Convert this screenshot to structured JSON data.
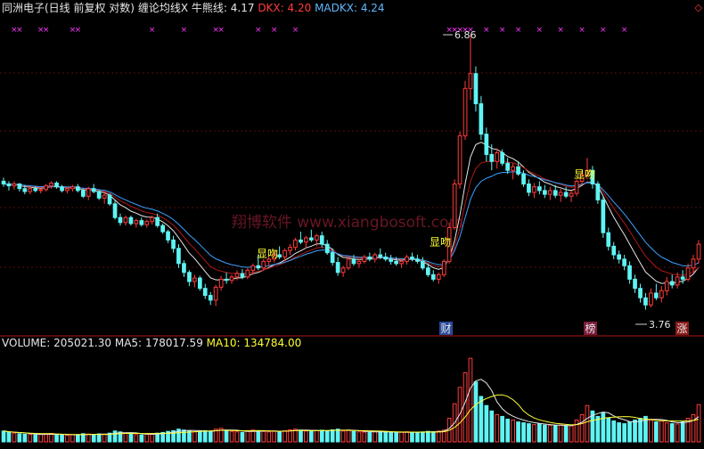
{
  "header": {
    "title": "同洲电子(日线 前复权 对数)",
    "indicator": "缠论均线X",
    "bull_bear_label": "牛熊线:",
    "bull_bear_value": "4.17",
    "dkx_label": "DKX:",
    "dkx_value": "4.20",
    "madkx_label": "MADKX:",
    "madkx_value": "4.24",
    "corner_icon": "diamond-icon"
  },
  "volume_header": {
    "volume_label": "VOLUME:",
    "volume_value": "205021.30",
    "ma5_label": "MA5:",
    "ma5_value": "178017.59",
    "ma10_label": "MA10:",
    "ma10_value": "134784.00"
  },
  "annotations": {
    "high_price": "6.86",
    "low_price": "3.76",
    "kiss_label": "显吻",
    "badge_cai": "财",
    "badge_bang": "榜",
    "badge_zhang": "涨",
    "watermark": "翔博软件 www.xiangbosoft.com"
  },
  "colors": {
    "up": "#ff3b3b",
    "down": "#5ff4f4",
    "ma_white": "#e6e6e6",
    "ma_red": "#b01818",
    "ma_blue": "#3aa0ff",
    "vol_ma10": "#ffff33",
    "marker": "#ff33ff"
  },
  "chart_data": {
    "type": "candlestick",
    "price_range": [
      3.7,
      6.9
    ],
    "volume_range": [
      0,
      500000
    ],
    "candles": [
      [
        4.98,
        5.02,
        4.92,
        4.95
      ],
      [
        4.95,
        4.98,
        4.88,
        4.93
      ],
      [
        4.93,
        4.98,
        4.89,
        4.95
      ],
      [
        4.95,
        4.96,
        4.87,
        4.9
      ],
      [
        4.9,
        4.94,
        4.84,
        4.87
      ],
      [
        4.87,
        4.92,
        4.84,
        4.9
      ],
      [
        4.9,
        4.93,
        4.86,
        4.88
      ],
      [
        4.88,
        4.9,
        4.85,
        4.89
      ],
      [
        4.89,
        4.95,
        4.87,
        4.93
      ],
      [
        4.93,
        4.98,
        4.9,
        4.96
      ],
      [
        4.96,
        4.98,
        4.9,
        4.92
      ],
      [
        4.92,
        4.94,
        4.86,
        4.88
      ],
      [
        4.88,
        4.91,
        4.85,
        4.9
      ],
      [
        4.9,
        4.94,
        4.87,
        4.92
      ],
      [
        4.92,
        4.95,
        4.86,
        4.88
      ],
      [
        4.88,
        4.9,
        4.8,
        4.82
      ],
      [
        4.82,
        4.92,
        4.78,
        4.9
      ],
      [
        4.9,
        4.95,
        4.85,
        4.87
      ],
      [
        4.87,
        4.89,
        4.78,
        4.8
      ],
      [
        4.8,
        4.86,
        4.74,
        4.83
      ],
      [
        4.83,
        4.85,
        4.72,
        4.74
      ],
      [
        4.74,
        4.78,
        4.58,
        4.6
      ],
      [
        4.6,
        4.64,
        4.52,
        4.55
      ],
      [
        4.55,
        4.62,
        4.52,
        4.6
      ],
      [
        4.6,
        4.62,
        4.52,
        4.54
      ],
      [
        4.54,
        4.59,
        4.5,
        4.57
      ],
      [
        4.57,
        4.6,
        4.51,
        4.53
      ],
      [
        4.53,
        4.58,
        4.5,
        4.56
      ],
      [
        4.56,
        4.62,
        4.53,
        4.6
      ],
      [
        4.6,
        4.64,
        4.5,
        4.52
      ],
      [
        4.52,
        4.54,
        4.44,
        4.46
      ],
      [
        4.46,
        4.48,
        4.35,
        4.38
      ],
      [
        4.38,
        4.42,
        4.26,
        4.3
      ],
      [
        4.3,
        4.34,
        4.12,
        4.16
      ],
      [
        4.16,
        4.19,
        4.04,
        4.08
      ],
      [
        4.08,
        4.1,
        3.96,
        4.0
      ],
      [
        4.0,
        4.06,
        3.95,
        4.03
      ],
      [
        4.03,
        4.05,
        3.92,
        3.94
      ],
      [
        3.94,
        3.98,
        3.85,
        3.88
      ],
      [
        3.88,
        3.91,
        3.8,
        3.84
      ],
      [
        3.84,
        3.97,
        3.79,
        3.95
      ],
      [
        3.95,
        4.05,
        3.92,
        4.02
      ],
      [
        4.02,
        4.08,
        3.98,
        4.01
      ],
      [
        4.01,
        4.06,
        3.98,
        4.04
      ],
      [
        4.04,
        4.1,
        4.01,
        4.07
      ],
      [
        4.07,
        4.11,
        4.02,
        4.04
      ],
      [
        4.04,
        4.12,
        4.02,
        4.1
      ],
      [
        4.1,
        4.16,
        4.06,
        4.14
      ],
      [
        4.14,
        4.24,
        4.1,
        4.12
      ],
      [
        4.12,
        4.2,
        4.1,
        4.18
      ],
      [
        4.18,
        4.23,
        4.14,
        4.2
      ],
      [
        4.2,
        4.27,
        4.17,
        4.24
      ],
      [
        4.24,
        4.32,
        4.2,
        4.22
      ],
      [
        4.22,
        4.3,
        4.18,
        4.28
      ],
      [
        4.28,
        4.34,
        4.24,
        4.31
      ],
      [
        4.31,
        4.4,
        4.28,
        4.38
      ],
      [
        4.38,
        4.46,
        4.34,
        4.36
      ],
      [
        4.36,
        4.42,
        4.3,
        4.4
      ],
      [
        4.4,
        4.48,
        4.36,
        4.38
      ],
      [
        4.38,
        4.44,
        4.32,
        4.42
      ],
      [
        4.42,
        4.46,
        4.31,
        4.34
      ],
      [
        4.34,
        4.38,
        4.24,
        4.26
      ],
      [
        4.26,
        4.3,
        4.14,
        4.17
      ],
      [
        4.17,
        4.22,
        4.05,
        4.08
      ],
      [
        4.08,
        4.14,
        4.04,
        4.12
      ],
      [
        4.12,
        4.22,
        4.1,
        4.2
      ],
      [
        4.2,
        4.24,
        4.14,
        4.16
      ],
      [
        4.16,
        4.2,
        4.12,
        4.18
      ],
      [
        4.18,
        4.24,
        4.16,
        4.22
      ],
      [
        4.22,
        4.26,
        4.18,
        4.2
      ],
      [
        4.2,
        4.26,
        4.17,
        4.24
      ],
      [
        4.24,
        4.3,
        4.2,
        4.22
      ],
      [
        4.22,
        4.26,
        4.18,
        4.2
      ],
      [
        4.2,
        4.24,
        4.15,
        4.18
      ],
      [
        4.18,
        4.22,
        4.14,
        4.16
      ],
      [
        4.16,
        4.2,
        4.12,
        4.18
      ],
      [
        4.18,
        4.24,
        4.15,
        4.22
      ],
      [
        4.22,
        4.26,
        4.18,
        4.2
      ],
      [
        4.2,
        4.24,
        4.16,
        4.18
      ],
      [
        4.18,
        4.22,
        4.1,
        4.12
      ],
      [
        4.12,
        4.16,
        4.04,
        4.06
      ],
      [
        4.06,
        4.1,
        4.0,
        4.02
      ],
      [
        4.02,
        4.08,
        3.98,
        4.06
      ],
      [
        4.06,
        4.2,
        4.04,
        4.18
      ],
      [
        4.18,
        4.55,
        4.16,
        4.5
      ],
      [
        4.5,
        5.0,
        4.48,
        4.95
      ],
      [
        4.95,
        5.55,
        4.9,
        5.5
      ],
      [
        5.5,
        6.2,
        5.45,
        6.1
      ],
      [
        6.1,
        6.86,
        5.95,
        6.3
      ],
      [
        6.3,
        6.4,
        5.8,
        5.9
      ],
      [
        5.9,
        6.0,
        5.45,
        5.52
      ],
      [
        5.52,
        5.6,
        5.2,
        5.28
      ],
      [
        5.28,
        5.4,
        5.1,
        5.2
      ],
      [
        5.2,
        5.35,
        5.12,
        5.3
      ],
      [
        5.3,
        5.34,
        5.15,
        5.18
      ],
      [
        5.18,
        5.24,
        5.06,
        5.1
      ],
      [
        5.1,
        5.18,
        5.0,
        5.14
      ],
      [
        5.14,
        5.2,
        5.04,
        5.06
      ],
      [
        5.06,
        5.1,
        4.92,
        4.95
      ],
      [
        4.95,
        5.0,
        4.82,
        4.86
      ],
      [
        4.86,
        4.96,
        4.8,
        4.92
      ],
      [
        4.92,
        4.98,
        4.84,
        4.88
      ],
      [
        4.88,
        4.94,
        4.8,
        4.84
      ],
      [
        4.84,
        4.92,
        4.78,
        4.88
      ],
      [
        4.88,
        4.94,
        4.8,
        4.83
      ],
      [
        4.83,
        4.9,
        4.76,
        4.86
      ],
      [
        4.86,
        4.92,
        4.8,
        4.82
      ],
      [
        4.82,
        4.88,
        4.76,
        4.85
      ],
      [
        4.85,
        5.0,
        4.82,
        4.98
      ],
      [
        4.98,
        5.1,
        4.94,
        5.05
      ],
      [
        5.05,
        5.24,
        5.0,
        5.1
      ],
      [
        5.1,
        5.15,
        4.9,
        4.95
      ],
      [
        4.95,
        4.98,
        4.74,
        4.78
      ],
      [
        4.78,
        4.82,
        4.4,
        4.45
      ],
      [
        4.45,
        4.5,
        4.28,
        4.32
      ],
      [
        4.32,
        4.36,
        4.2,
        4.24
      ],
      [
        4.24,
        4.28,
        4.16,
        4.2
      ],
      [
        4.2,
        4.24,
        4.1,
        4.14
      ],
      [
        4.14,
        4.18,
        3.98,
        4.02
      ],
      [
        4.02,
        4.06,
        3.9,
        3.94
      ],
      [
        3.94,
        3.98,
        3.82,
        3.86
      ],
      [
        3.86,
        3.9,
        3.76,
        3.8
      ],
      [
        3.8,
        3.94,
        3.78,
        3.9
      ],
      [
        3.9,
        3.98,
        3.84,
        3.86
      ],
      [
        3.86,
        3.96,
        3.82,
        3.92
      ],
      [
        3.92,
        4.04,
        3.88,
        4.0
      ],
      [
        4.0,
        4.06,
        3.94,
        3.97
      ],
      [
        3.97,
        4.08,
        3.94,
        4.04
      ],
      [
        4.04,
        4.1,
        3.98,
        4.02
      ],
      [
        4.02,
        4.16,
        4.0,
        4.12
      ],
      [
        4.12,
        4.24,
        4.08,
        4.2
      ],
      [
        4.2,
        4.38,
        4.16,
        4.34
      ]
    ],
    "volumes": [
      60000,
      52000,
      48000,
      45000,
      42000,
      40000,
      38000,
      41000,
      44000,
      46000,
      40000,
      38000,
      36000,
      39000,
      40000,
      45000,
      43000,
      40000,
      44000,
      42000,
      48000,
      60000,
      55000,
      48000,
      44000,
      40000,
      38000,
      42000,
      45000,
      48000,
      52000,
      58000,
      62000,
      70000,
      65000,
      60000,
      55000,
      58000,
      62000,
      60000,
      70000,
      75000,
      62000,
      58000,
      55000,
      52000,
      60000,
      65000,
      62000,
      58000,
      55000,
      60000,
      58000,
      62000,
      66000,
      70000,
      65000,
      60000,
      58000,
      62000,
      64000,
      62000,
      66000,
      70000,
      60000,
      65000,
      58000,
      55000,
      54000,
      52000,
      56000,
      58000,
      54000,
      52000,
      50000,
      53000,
      56000,
      54000,
      52000,
      55000,
      58000,
      56000,
      60000,
      65000,
      130000,
      210000,
      300000,
      380000,
      460000,
      330000,
      250000,
      200000,
      170000,
      150000,
      140000,
      125000,
      120000,
      110000,
      105000,
      100000,
      95000,
      98000,
      92000,
      90000,
      88000,
      92000,
      90000,
      88000,
      120000,
      150000,
      200000,
      170000,
      140000,
      160000,
      130000,
      115000,
      105000,
      100000,
      110000,
      120000,
      130000,
      140000,
      120000,
      110000,
      115000,
      105000,
      100000,
      98000,
      110000,
      130000,
      150000,
      205021
    ],
    "markers": {
      "top_indices": [
        2,
        3,
        7,
        8,
        13,
        14,
        28,
        34,
        40,
        41,
        48,
        51,
        55,
        84,
        85,
        86,
        87,
        88,
        91,
        94,
        97,
        101,
        105,
        109,
        113,
        117
      ]
    }
  }
}
